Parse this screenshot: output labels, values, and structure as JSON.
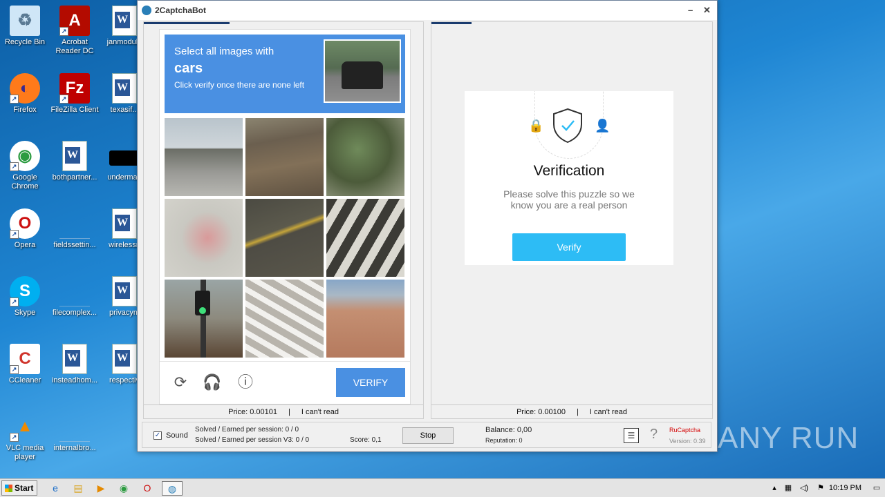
{
  "desktop": {
    "icons": [
      {
        "label": "Recycle Bin",
        "icon": "recycle-bin-icon"
      },
      {
        "label": "Acrobat Reader DC",
        "icon": "acrobat-icon"
      },
      {
        "label": "janmodule",
        "icon": "word-doc-icon"
      },
      {
        "label": "Firefox",
        "icon": "firefox-icon"
      },
      {
        "label": "FileZilla Client",
        "icon": "filezilla-icon"
      },
      {
        "label": "texasif...",
        "icon": "word-doc-icon"
      },
      {
        "label": "Google Chrome",
        "icon": "chrome-icon"
      },
      {
        "label": "bothpartner...",
        "icon": "word-doc-icon"
      },
      {
        "label": "underman",
        "icon": "black-file-icon"
      },
      {
        "label": "Opera",
        "icon": "opera-icon"
      },
      {
        "label": "fieldssettin...",
        "icon": "blank-file-icon"
      },
      {
        "label": "wirelessn",
        "icon": "word-doc-icon"
      },
      {
        "label": "Skype",
        "icon": "skype-icon"
      },
      {
        "label": "filecomplex...",
        "icon": "blank-file-icon"
      },
      {
        "label": "privacym",
        "icon": "word-doc-icon"
      },
      {
        "label": "CCleaner",
        "icon": "ccleaner-icon"
      },
      {
        "label": "insteadhom...",
        "icon": "word-doc-icon"
      },
      {
        "label": "respectiv",
        "icon": "word-doc-icon"
      },
      {
        "label": "VLC media player",
        "icon": "vlc-icon"
      },
      {
        "label": "internalbro...",
        "icon": "blank-file-icon"
      }
    ],
    "watermark": "ANY RUN"
  },
  "window": {
    "title": "2CaptchaBot",
    "minimize": "–",
    "close": "✕"
  },
  "captcha": {
    "line1": "Select all images with",
    "target": "cars",
    "line3": "Click verify once there are none left",
    "verify_label": "VERIFY",
    "reload_icon": "⟳",
    "audio_icon": "🎧",
    "info_icon": "ⓘ"
  },
  "left_pane": {
    "price": "Price: 0.00101",
    "separator": "|",
    "cant_read": "I can't read"
  },
  "right_pane": {
    "title": "Verification",
    "text": "Please solve this puzzle so we know you are a real person",
    "verify_label": "Verify",
    "price": "Price: 0.00100",
    "separator": "|",
    "cant_read": "I can't read"
  },
  "status": {
    "sound_label": "Sound",
    "sound_checked": "✓",
    "solved1": "Solved / Earned per session: 0 / 0",
    "solved2": "Solved / Earned per session V3: 0 / 0",
    "score": "Score: 0,1",
    "stop_label": "Stop",
    "balance": "Balance:  0,00",
    "reputation": "Reputation: 0",
    "service": "RuCaptcha",
    "version": "Version: 0.39",
    "service_color": "#d40000"
  },
  "taskbar": {
    "start_label": "Start",
    "clock": "10:19 PM"
  }
}
